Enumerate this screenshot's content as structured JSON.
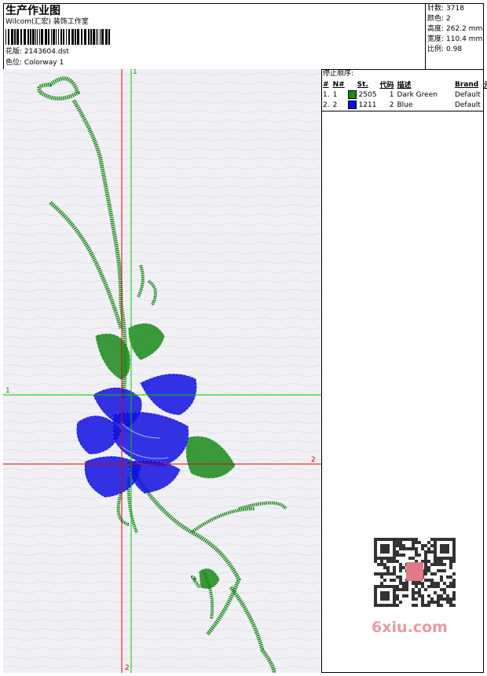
{
  "header": {
    "title": "生产作业图",
    "company": "Wilcom(汇宏) 装饰工作室",
    "design_label": "花版:",
    "design_value": "2143604.dst",
    "colorway_label": "色位:",
    "colorway_value": "Colorway 1"
  },
  "stats": [
    {
      "label": "针数:",
      "value": "3718"
    },
    {
      "label": "颜色:",
      "value": "2"
    },
    {
      "label": "高度:",
      "value": "262.2 mm"
    },
    {
      "label": "宽度:",
      "value": "110.4 mm"
    },
    {
      "label": "比例:",
      "value": "0.98"
    }
  ],
  "stop_sequence": {
    "title": "停止顺序:",
    "columns": [
      "#",
      "N#",
      "St.",
      "代码",
      "描述",
      "Brand",
      "元素"
    ],
    "rows": [
      {
        "idx": "1.",
        "n": "1",
        "color": "#1a8a1a",
        "st": "2505",
        "code": "1",
        "desc": "Dark Green",
        "brand": "Default"
      },
      {
        "idx": "2.",
        "n": "2",
        "color": "#1010e0",
        "st": "1211",
        "code": "2",
        "desc": "Blue",
        "brand": "Default"
      }
    ]
  },
  "axes": {
    "v1_top": "1",
    "v2_bottom": "2",
    "h1_left": "1",
    "h2_right": "2"
  },
  "colors": {
    "green_line": "#00cc00",
    "red_line": "#e00000",
    "thread_green": "#1a8a1a",
    "thread_blue": "#1010e0"
  },
  "watermark": {
    "text": "6xiu.com"
  }
}
